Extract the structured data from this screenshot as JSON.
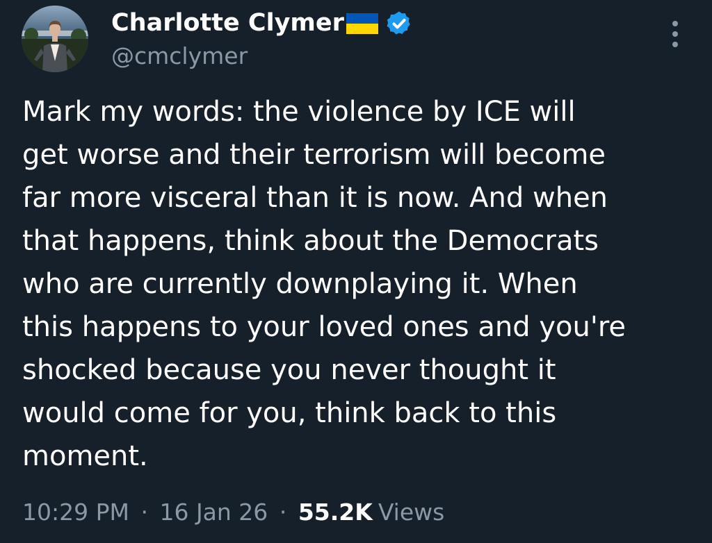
{
  "author": {
    "display_name": "Charlotte Clymer",
    "handle": "@cmclymer",
    "flag_icon": "ukraine-flag-icon",
    "verified_icon": "verified-badge-icon",
    "verified_color": "#1d9bf0"
  },
  "tweet": {
    "lines": [
      "Mark my words: the violence by ICE will",
      "get worse and their terrorism will become",
      "far more visceral than it is now. And when",
      "that happens, think about the Democrats",
      "who are currently downplaying it. When",
      "this happens to your loved ones and you're",
      "shocked because you never thought it",
      "would come for you, think back to this",
      "moment."
    ]
  },
  "meta": {
    "time": "10:29 PM",
    "separator": "·",
    "date": "16 Jan 26",
    "views_count": "55.2K",
    "views_label": "Views"
  },
  "colors": {
    "background": "#15202b",
    "secondary_text": "#8b98a5",
    "primary_text": "#ffffff",
    "flag_blue": "#0057b7",
    "flag_yellow": "#ffd700"
  },
  "more_icon": "more-vertical-icon"
}
